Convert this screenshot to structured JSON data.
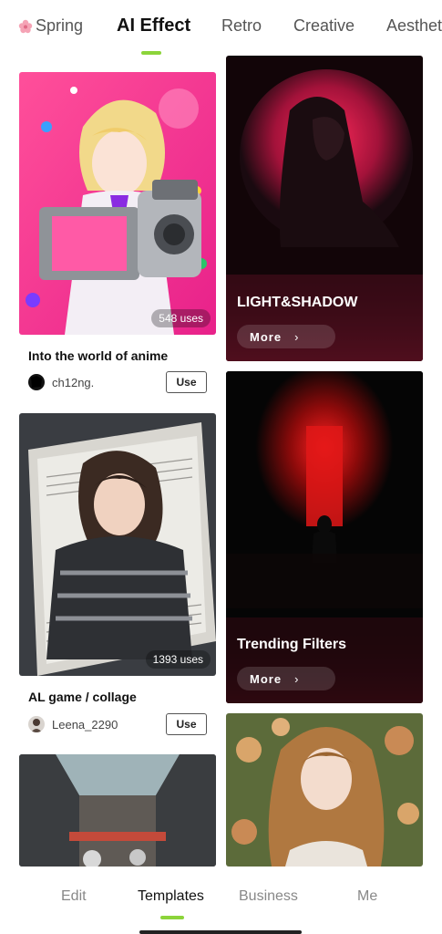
{
  "top_tabs": {
    "items": [
      {
        "label": "Spring",
        "icon": "flower-icon"
      },
      {
        "label": "AI Effect"
      },
      {
        "label": "Retro"
      },
      {
        "label": "Creative"
      },
      {
        "label": "Aesthet"
      }
    ],
    "active_index": 1,
    "accent_color": "#8cd43a"
  },
  "left_cards": [
    {
      "title": "Into the world of anime",
      "uses": "548 uses",
      "author": "ch12ng.",
      "use_label": "Use"
    },
    {
      "title": "AL game / collage",
      "uses": "1393 uses",
      "author": "Leena_2290",
      "use_label": "Use"
    },
    {
      "title": "",
      "uses": "",
      "author": "",
      "use_label": ""
    }
  ],
  "right_cards": [
    {
      "title": "LIGHT&SHADOW",
      "more_label": "More"
    },
    {
      "title": "Trending Filters",
      "more_label": "More"
    },
    {
      "title": ""
    }
  ],
  "bottom_nav": {
    "items": [
      {
        "label": "Edit"
      },
      {
        "label": "Templates"
      },
      {
        "label": "Business"
      },
      {
        "label": "Me"
      }
    ],
    "active_index": 1
  }
}
